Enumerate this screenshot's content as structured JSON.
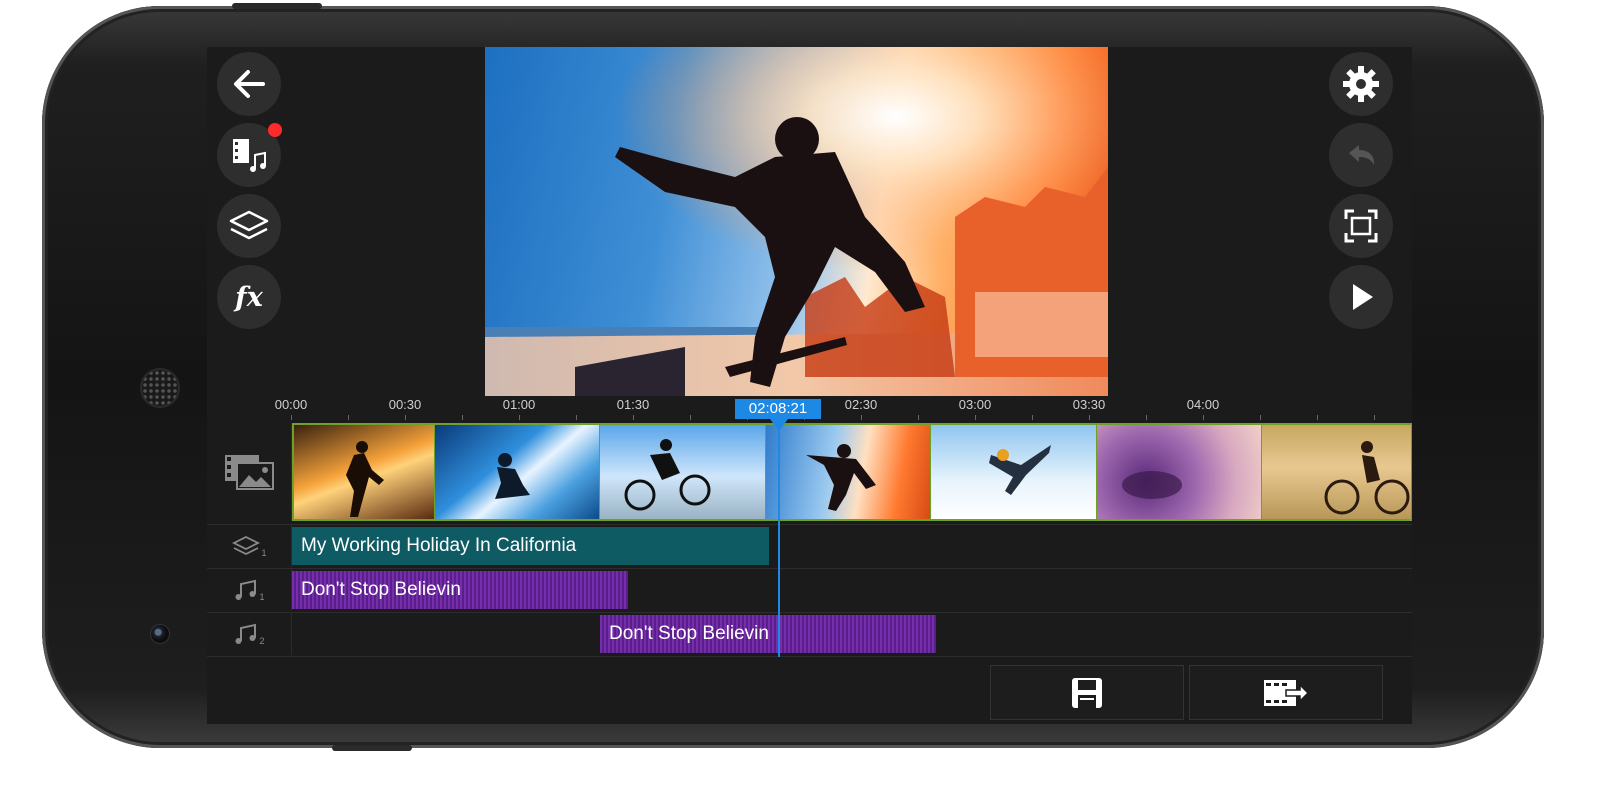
{
  "app": {
    "left_toolbar": [
      {
        "name": "back",
        "icon": "arrow-left-icon"
      },
      {
        "name": "media",
        "icon": "media-music-icon",
        "has_badge": true
      },
      {
        "name": "layers",
        "icon": "layers-icon"
      },
      {
        "name": "effects",
        "icon": "fx-icon",
        "label": "fx"
      }
    ],
    "right_toolbar": [
      {
        "name": "settings",
        "icon": "gear-icon"
      },
      {
        "name": "undo",
        "icon": "undo-icon",
        "enabled": false
      },
      {
        "name": "fullscreen",
        "icon": "fullscreen-icon"
      },
      {
        "name": "play",
        "icon": "play-icon"
      }
    ]
  },
  "timeline": {
    "ruler_labels": [
      "00:00",
      "00:30",
      "01:00",
      "01:30",
      "02:30",
      "03:00",
      "03:30",
      "04:00"
    ],
    "playhead_time": "02:08:21",
    "tracks": {
      "video_icon": "video-photo-track-icon",
      "layer_icon": "layers-track-icon",
      "layer_index": "1",
      "audio1_icon": "music-note-icon",
      "audio1_index": "1",
      "audio2_icon": "music-note-icon",
      "audio2_index": "2"
    },
    "text_clip": {
      "label": "My Working Holiday In California"
    },
    "audio_clip_1": {
      "label": "Don't Stop Believin"
    },
    "audio_clip_2": {
      "label": "Don't Stop Believin"
    }
  },
  "bottom_actions": [
    {
      "name": "save",
      "icon": "save-icon"
    },
    {
      "name": "export",
      "icon": "export-video-icon"
    }
  ],
  "colors": {
    "accent": "#1e88e5",
    "video_track_border": "#6fa027",
    "text_clip": "#0f5b64",
    "audio_clip": "#5a1e8a",
    "badge": "#ff2a2a"
  }
}
